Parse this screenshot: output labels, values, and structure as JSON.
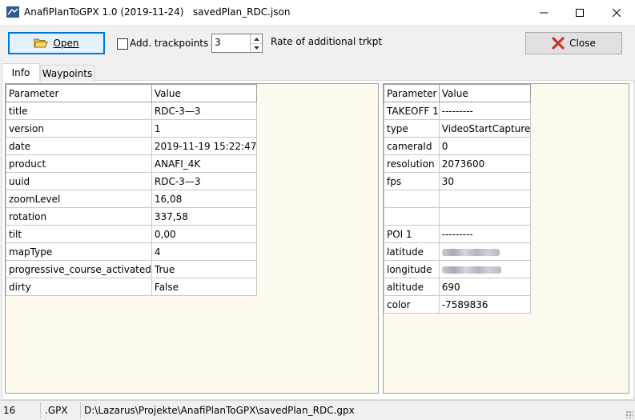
{
  "window": {
    "title": "AnafiPlanToGPX 1.0 (2019-11-24)   savedPlan_RDC.json"
  },
  "toolbar": {
    "open_label": "Open",
    "add_trackpoints_label": "Add. trackpoints",
    "add_trackpoints_checked": false,
    "spin_value": "3",
    "rate_label": "Rate of additional trkpt",
    "close_label": "Close"
  },
  "tabs": [
    {
      "label": "Info",
      "active": true
    },
    {
      "label": "Waypoints",
      "active": false
    }
  ],
  "info_table": {
    "headers": [
      "Parameter",
      "Value"
    ],
    "rows": [
      [
        "title",
        "RDC-3—3"
      ],
      [
        "version",
        "1"
      ],
      [
        "date",
        "2019-11-19 15:22:47"
      ],
      [
        "product",
        "ANAFI_4K"
      ],
      [
        "uuid",
        "RDC-3—3"
      ],
      [
        "zoomLevel",
        "16,08"
      ],
      [
        "rotation",
        "337,58"
      ],
      [
        "tilt",
        "0,00"
      ],
      [
        "mapType",
        "4"
      ],
      [
        "progressive_course_activated",
        "True"
      ],
      [
        "dirty",
        "False"
      ]
    ]
  },
  "wp_table": {
    "headers": [
      "Parameter",
      "Value"
    ],
    "rows": [
      [
        "TAKEOFF 1",
        "---------"
      ],
      [
        "type",
        "VideoStartCapture"
      ],
      [
        "cameraId",
        "0"
      ],
      [
        "resolution",
        "2073600"
      ],
      [
        "fps",
        "30"
      ],
      [
        "",
        ""
      ],
      [
        "",
        ""
      ],
      [
        "POI 1",
        "---------"
      ],
      [
        "latitude",
        ""
      ],
      [
        "longitude",
        ""
      ],
      [
        "altitude",
        "690"
      ],
      [
        "color",
        "-7589836"
      ]
    ],
    "blurred_rows": [
      8,
      9
    ]
  },
  "statusbar": {
    "count": "16",
    "ext": ".GPX",
    "path": "D:\\Lazarus\\Projekte\\AnafiPlanToGPX\\savedPlan_RDC.gpx"
  },
  "colors": {
    "panel_bg": "#fdf9ee",
    "accent": "#0078d7",
    "close_x": "#c0392b"
  }
}
